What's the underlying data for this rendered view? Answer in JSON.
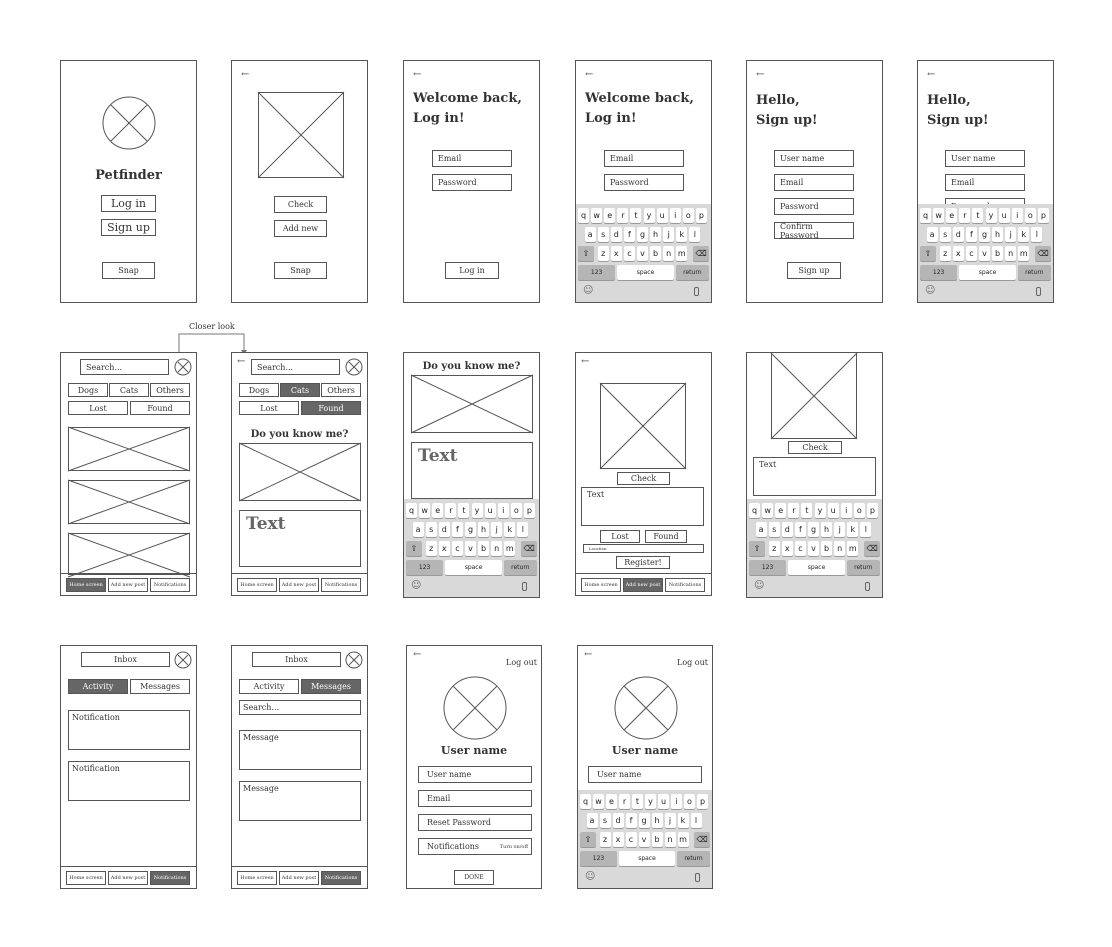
{
  "icons": {
    "back": "←",
    "close": "close-circle-icon",
    "image": "image-placeholder-icon",
    "emoji": "☺",
    "mic": "🎙"
  },
  "s1": {
    "app_name": "Petfinder",
    "login": "Log in",
    "signup": "Sign up",
    "snap": "Snap"
  },
  "s2": {
    "check": "Check",
    "add_new": "Add new",
    "snap": "Snap"
  },
  "s3": {
    "title1": "Welcome back,",
    "title2": "Log in!",
    "email": "Email",
    "password": "Password",
    "login": "Log in"
  },
  "s4": {
    "title1": "Welcome back,",
    "title2": "Log in!",
    "email": "Email",
    "password": "Password"
  },
  "s5": {
    "title1": "Hello,",
    "title2": "Sign up!",
    "username": "User name",
    "email": "Email",
    "password": "Password",
    "confirm": "Confirm Password",
    "signup": "Sign up"
  },
  "s6": {
    "title1": "Hello,",
    "title2": "Sign up!",
    "username": "User name",
    "email": "Email",
    "password": "Password"
  },
  "annotation": "Closer look",
  "feed": {
    "search": "Search...",
    "dogs": "Dogs",
    "cats": "Cats",
    "others": "Others",
    "lost": "Lost",
    "found": "Found"
  },
  "detail": {
    "question": "Do you know me?",
    "text": "Text"
  },
  "newpost": {
    "check": "Check",
    "text": "Text",
    "lost": "Lost",
    "found": "Found",
    "location": "Location",
    "register": "Register!"
  },
  "nav": {
    "home": "Home screen",
    "add": "Add new post",
    "notifications": "Notifications"
  },
  "inbox": {
    "title": "Inbox",
    "activity": "Activity",
    "messages": "Messages",
    "notification": "Notification",
    "search": "Search...",
    "message": "Message"
  },
  "profile": {
    "logout": "Log out",
    "username_title": "User name",
    "username": "User name",
    "email": "Email",
    "reset": "Reset Password",
    "notifications": "Notifications",
    "toggle": "Turn on/off",
    "done": "DONE"
  },
  "keyboard": {
    "row1": [
      "q",
      "w",
      "e",
      "r",
      "t",
      "y",
      "u",
      "i",
      "o",
      "p"
    ],
    "row2": [
      "a",
      "s",
      "d",
      "f",
      "g",
      "h",
      "j",
      "k",
      "l"
    ],
    "row3": [
      "z",
      "x",
      "c",
      "v",
      "b",
      "n",
      "m"
    ],
    "shift": "⇧",
    "delete": "⌫",
    "num": "123",
    "space": "space",
    "return": "return"
  }
}
